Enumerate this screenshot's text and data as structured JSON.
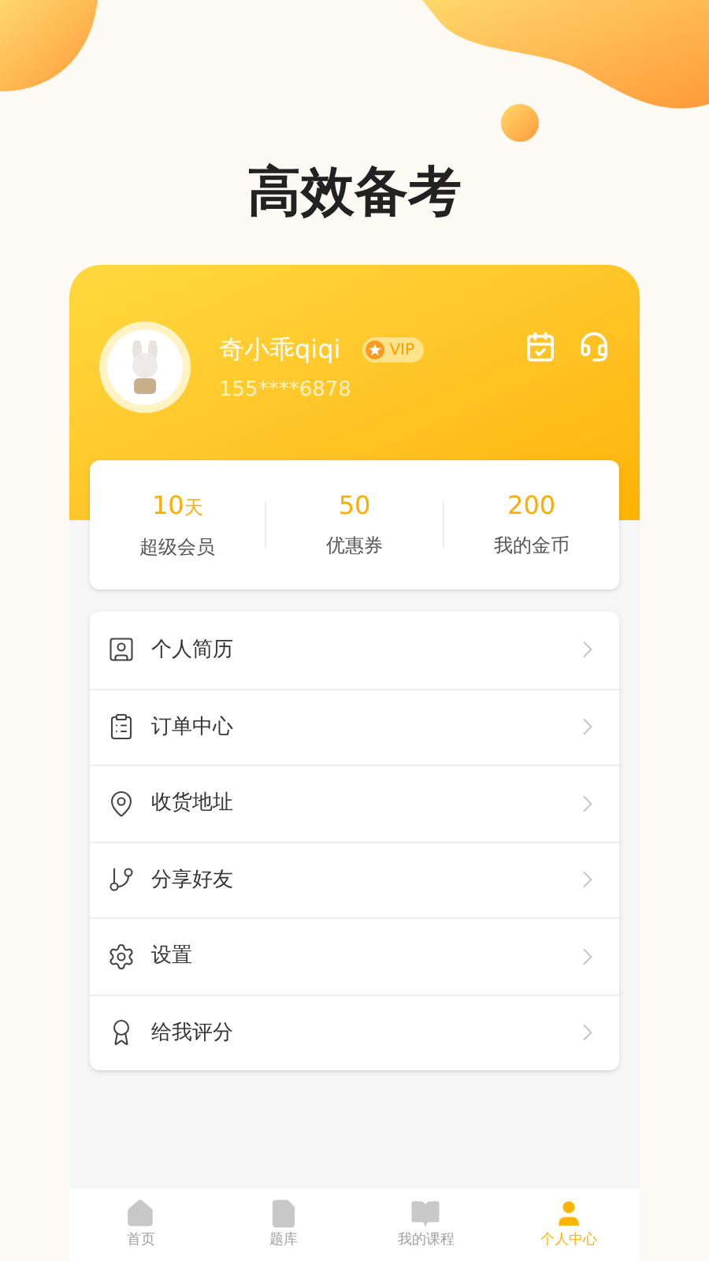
{
  "headline": "高效备考",
  "profile": {
    "name": "奇小乖qiqi",
    "badge": "VIP",
    "phone": "155****6878"
  },
  "stats": [
    {
      "value": "10",
      "unit": "天",
      "label": "超级会员"
    },
    {
      "value": "50",
      "label": "优惠券"
    },
    {
      "value": "200",
      "label": "我的金币"
    }
  ],
  "menu": [
    {
      "kind": "resume",
      "label": "个人简历"
    },
    {
      "kind": "orders",
      "label": "订单中心"
    },
    {
      "kind": "address",
      "label": "收货地址"
    },
    {
      "kind": "share",
      "label": "分享好友"
    },
    {
      "kind": "settings",
      "label": "设置"
    },
    {
      "kind": "rate",
      "label": "给我评分"
    }
  ],
  "tabs": [
    {
      "kind": "home",
      "label": "首页",
      "selected": false
    },
    {
      "kind": "bank",
      "label": "题库",
      "selected": false
    },
    {
      "kind": "courses",
      "label": "我的课程",
      "selected": false
    },
    {
      "kind": "me",
      "label": "个人中心",
      "selected": true
    }
  ]
}
